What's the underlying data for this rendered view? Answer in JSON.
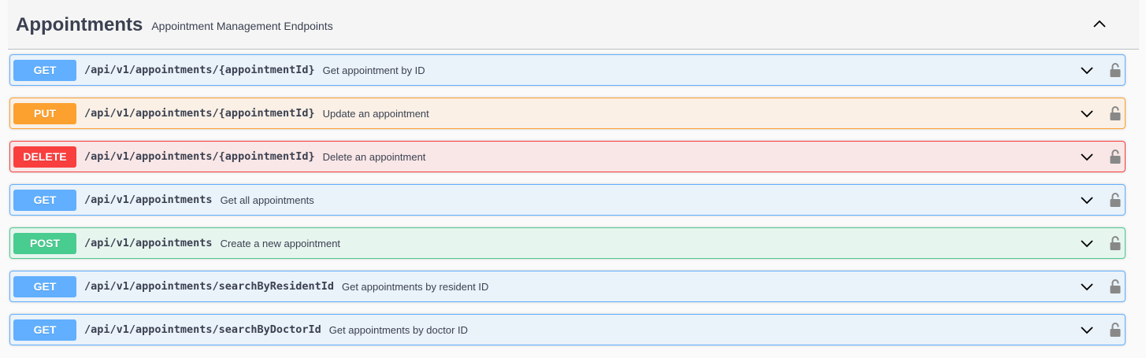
{
  "tag": {
    "title": "Appointments",
    "description": "Appointment Management Endpoints"
  },
  "colors": {
    "get": "#61affe",
    "put": "#fca130",
    "delete": "#f93e3e",
    "post": "#49cc90"
  },
  "operations": [
    {
      "method": "GET",
      "path": "/api/v1/appointments/{appointmentId}",
      "summary": "Get appointment by ID"
    },
    {
      "method": "PUT",
      "path": "/api/v1/appointments/{appointmentId}",
      "summary": "Update an appointment"
    },
    {
      "method": "DELETE",
      "path": "/api/v1/appointments/{appointmentId}",
      "summary": "Delete an appointment"
    },
    {
      "method": "GET",
      "path": "/api/v1/appointments",
      "summary": "Get all appointments"
    },
    {
      "method": "POST",
      "path": "/api/v1/appointments",
      "summary": "Create a new appointment"
    },
    {
      "method": "GET",
      "path": "/api/v1/appointments/searchByResidentId",
      "summary": "Get appointments by resident ID"
    },
    {
      "method": "GET",
      "path": "/api/v1/appointments/searchByDoctorId",
      "summary": "Get appointments by doctor ID"
    }
  ],
  "icons": {
    "collapse": "chevron-up-icon",
    "expand": "chevron-down-icon",
    "auth": "unlocked-padlock-icon"
  }
}
